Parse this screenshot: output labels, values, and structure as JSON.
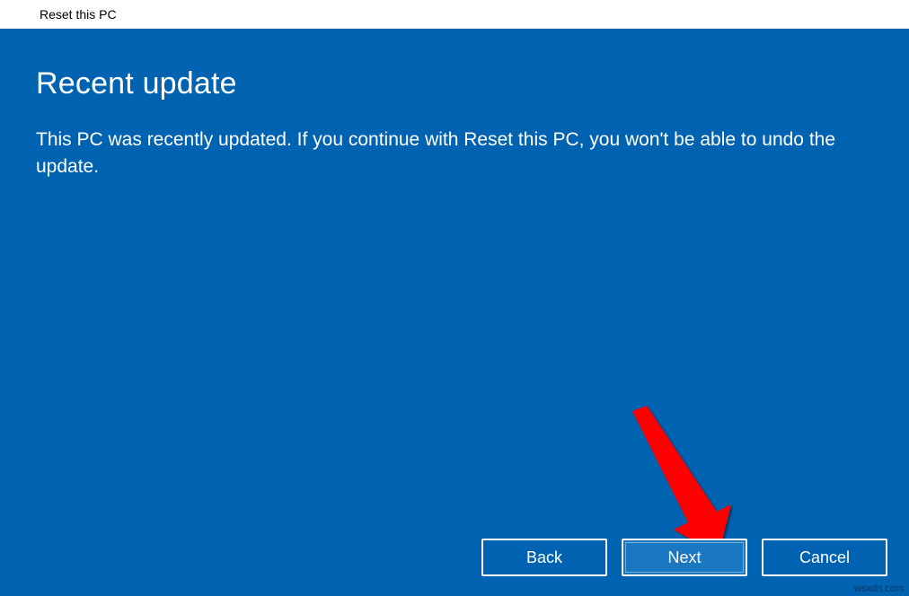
{
  "titlebar": {
    "title": "Reset this PC"
  },
  "main": {
    "heading": "Recent update",
    "body": "This PC was recently updated. If you continue with Reset this PC, you won't be able to undo the update."
  },
  "buttons": {
    "back": "Back",
    "next": "Next",
    "cancel": "Cancel"
  },
  "watermark": "wsxdn.com"
}
